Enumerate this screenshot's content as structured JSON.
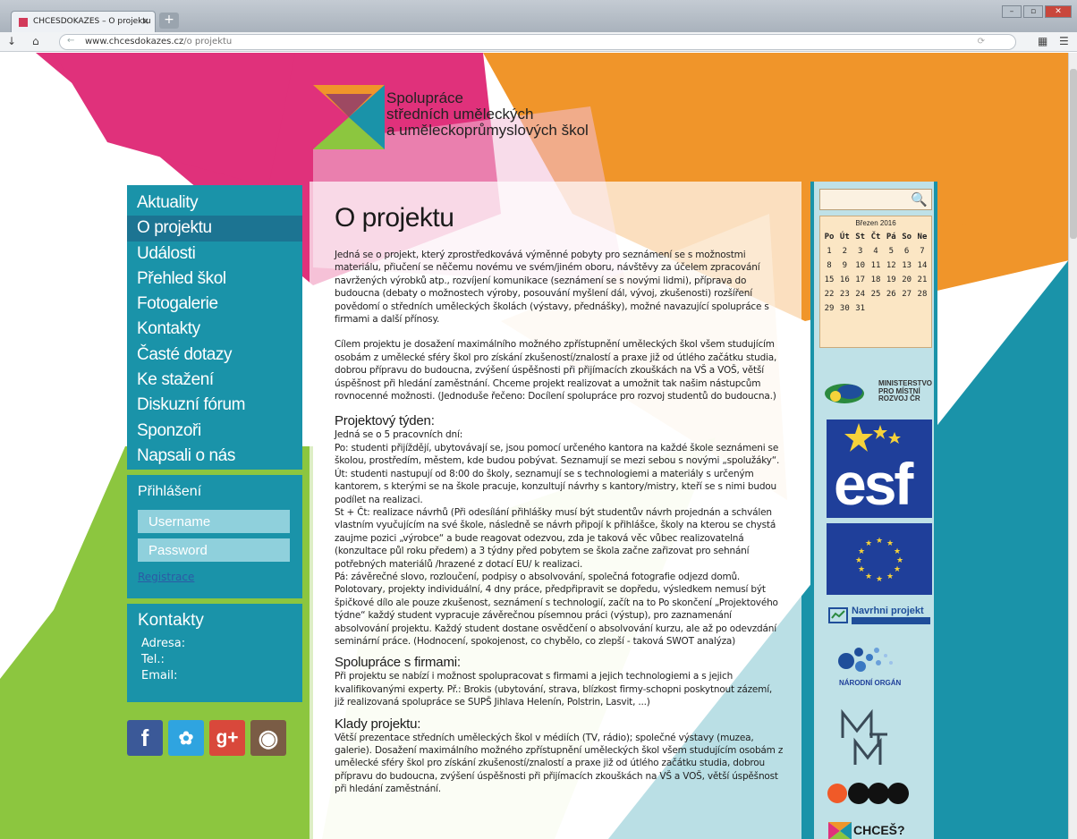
{
  "browser": {
    "tab_title": "CHCESDOKAZES – O projektu",
    "tab_close": "×",
    "new_tab": "+",
    "url_domain": "www.chcesdokazes.cz",
    "url_path": "/o projektu",
    "back_icon": "arrow-down-icon",
    "home_icon": "home-icon",
    "win_minimize": "–",
    "win_restore": "▫",
    "win_close": "✕"
  },
  "logo": {
    "line1": "Spolupráce",
    "line2": "středních uměleckých",
    "line3": "a uměleckoprůmyslových škol"
  },
  "nav": {
    "items": [
      {
        "label": "Aktuality"
      },
      {
        "label": "O projektu"
      },
      {
        "label": "Události"
      },
      {
        "label": "Přehled škol"
      },
      {
        "label": "Fotogalerie"
      },
      {
        "label": "Kontakty"
      },
      {
        "label": "Časté dotazy"
      },
      {
        "label": "Ke stažení"
      },
      {
        "label": "Diskuzní fórum"
      },
      {
        "label": "Sponzoři"
      },
      {
        "label": "Napsali o nás"
      }
    ],
    "active_index": 1
  },
  "login": {
    "title": "Přihlášení",
    "username_placeholder": "Username",
    "password_placeholder": "Password",
    "register": "Registrace"
  },
  "contacts": {
    "title": "Kontakty",
    "address": "Adresa:",
    "phone": "Tel.:",
    "email": "Email:"
  },
  "social": {
    "facebook": "f",
    "twitter": "t",
    "googleplus": "g+",
    "instagram": "◉"
  },
  "main": {
    "title": "O projektu",
    "p1": "Jedná se o projekt, který zprostředkovává výměnné pobyty pro seznámení se s možnostmi materiálu, přiučení se něčemu novému ve svém/jiném oboru, návštěvy za účelem zpracování navržených výrobků atp., rozvíjení komunikace (seznámení se s novými lidmi), příprava do budoucna (debaty o možnostech výroby, posouvání myšlení dál, vývoj, zkušenosti) rozšíření povědomí o středních uměleckých školách (výstavy, přednášky), možné navazující spolupráce s firmami a další přínosy.",
    "p2": "Cílem projektu je dosažení maximálního možného zpřístupnění uměleckých škol všem studujícím osobám z umělecké sféry škol pro získání zkušeností/znalostí a praxe již od útlého začátku studia, dobrou přípravu do budoucna, zvýšení úspěšnosti při přijímacích zkouškách na VŠ a VOŠ, větší úspěšnost při hledání zaměstnání. Chceme projekt realizovat a umožnit tak našim nástupcům rovnocenné možnosti. (Jednoduše řečeno: Docílení spolupráce pro rozvoj studentů do budoucna.)",
    "h_tyden": "Projektový týden:",
    "tyden_intro": "Jedná se o 5 pracovních dní:",
    "tyden_po": "Po: studenti přijíždějí, ubytovávají se, jsou pomocí určeného kantora na každé škole seznámeni se školou, prostředím, městem, kde budou pobývat. Seznamují se mezi sebou s novými „spolužáky“.",
    "tyden_ut": "Út: studenti nastupují od 8:00 do školy, seznamují se s technologiemi a materiály s určeným kantorem, s kterými se na škole pracuje, konzultují návrhy s kantory/mistry, kteří se s nimi budou podílet na realizaci.",
    "tyden_st": "St + Čt: realizace návrhů (Při odesílání přihlášky musí být studentův návrh projednán a schválen vlastním vyučujícím na své škole, následně se návrh připojí k přihlášce, školy na kterou se chystá zaujme pozici „výrobce“ a bude reagovat odezvou, zda je taková věc vůbec realizovatelná (konzultace půl roku předem) a 3 týdny před pobytem se škola začne zařizovat pro sehnání potřebných materiálů /hrazené z dotací EU/ k realizaci.",
    "tyden_pa": "Pá: závěrečné slovo, rozloučení, podpisy o absolvování, společná fotografie odjezd domů. Polotovary, projekty individuální, 4 dny práce, předpřipravit se dopředu, výsledkem nemusí být špičkové dílo ale pouze zkušenost, seznámení s technologií, začít na to Po skončení „Projektového týdne“ každý student vypracuje závěrečnou písemnou práci (výstup), pro zaznamenání absolvování projektu. Každý student dostane osvědčení o absolvování kurzu, ale až po odevzdání seminární práce. (Hodnocení, spokojenost, co chybělo, co zlepší - taková SWOT analýza)",
    "h_firmy": "Spolupráce s firmami:",
    "firmy": "Při projektu se nabízí i možnost spolupracovat s firmami a jejich technologiemi a s jejich kvalifikovanými experty. Př.: Brokis (ubytování, strava, blízkost firmy-schopni poskytnout zázemí, již realizovaná spolupráce se SUPŠ Jihlava Helenín, Polstrin, Lasvit, ...)",
    "h_klady": "Klady projektu:",
    "klady": "Větší prezentace středních uměleckých škol v médiích (TV, rádio); společné výstavy (muzea, galerie). Dosažení maximálního možného zpřístupnění uměleckých škol všem studujícím osobám z umělecké sféry škol pro získání zkušeností/znalostí a praxe již od útlého začátku studia, dobrou přípravu do budoucna, zvýšení úspěšnosti při přijímacích zkouškách na VŠ a VOŠ, větší úspěšnost při hledání zaměstnání."
  },
  "sidebar": {
    "search_icon": "search-icon",
    "calendar": {
      "title": "Březen 2016",
      "headers": [
        "Po",
        "Út",
        "St",
        "Čt",
        "Pá",
        "So",
        "Ne"
      ],
      "weeks": [
        [
          "1",
          "2",
          "3",
          "4",
          "5",
          "6",
          "7"
        ],
        [
          "8",
          "9",
          "10",
          "11",
          "12",
          "13",
          "14"
        ],
        [
          "15",
          "16",
          "17",
          "18",
          "19",
          "20",
          "21"
        ],
        [
          "22",
          "23",
          "24",
          "25",
          "26",
          "27",
          "28"
        ],
        [
          "29",
          "30",
          "31",
          "",
          "",
          "",
          ""
        ]
      ]
    },
    "mmr": "MINISTERSTVO PRO MÍSTNÍ ROZVOJ ČR",
    "esf": "esf",
    "navrhni": "Navrhni projekt",
    "narodni": "NÁRODNÍ ORGÁN",
    "chces": "CHCEŠ?"
  },
  "colors": {
    "nav_bg": "#1a93a9",
    "nav_active": "#1c7492",
    "pink": "#e0317b",
    "orange": "#f0952a",
    "green": "#8cc63f",
    "teal": "#1a93a9"
  }
}
